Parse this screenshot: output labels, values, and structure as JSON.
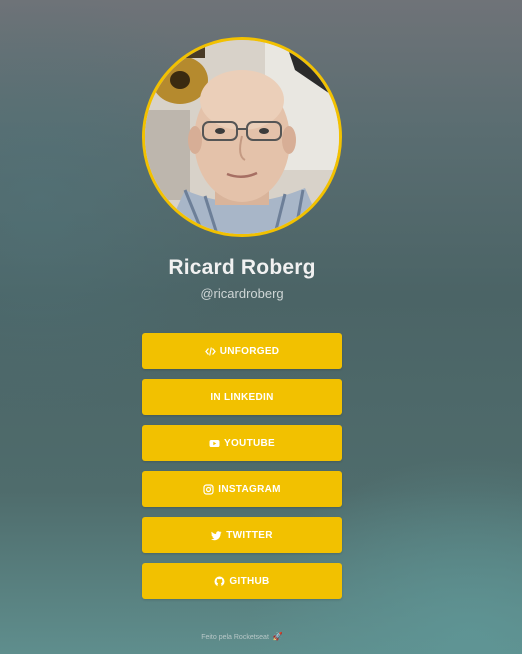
{
  "profile": {
    "name": "Ricard Roberg",
    "handle": "@ricardroberg",
    "avatar_alt": "profile-photo"
  },
  "links": [
    {
      "label": "UNFORGED",
      "icon": "code-icon"
    },
    {
      "label": "IN LINKEDIN",
      "icon": ""
    },
    {
      "label": "YOUTUBE",
      "icon": "youtube-icon"
    },
    {
      "label": "INSTAGRAM",
      "icon": "instagram-icon"
    },
    {
      "label": "TWITTER",
      "icon": "twitter-icon"
    },
    {
      "label": "GITHUB",
      "icon": "github-icon"
    }
  ],
  "footer": {
    "text": "Feito pela Rocketseat",
    "icon": "rocket-icon"
  },
  "colors": {
    "accent": "#f2c100",
    "background_top": "#6f7378",
    "background_bottom": "#5f8e8d"
  }
}
